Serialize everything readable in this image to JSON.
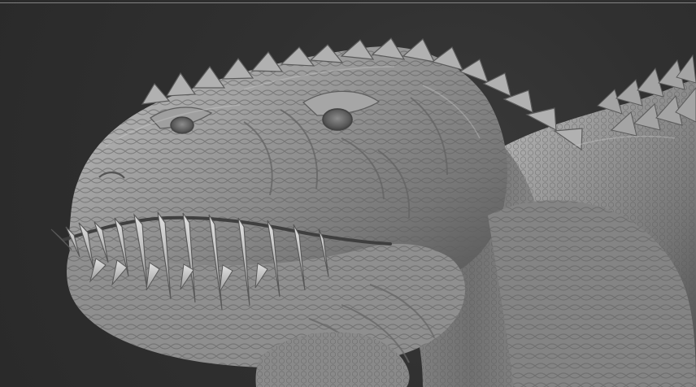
{
  "viewport": {
    "background_color": "#2f2f2f",
    "divider_color": "#8b8b8b"
  },
  "model": {
    "name": "dinosaur-sculpt",
    "skin_light": "#b8b8b8",
    "skin_mid": "#8f8f8f",
    "skin_dark": "#4e4e4e"
  }
}
